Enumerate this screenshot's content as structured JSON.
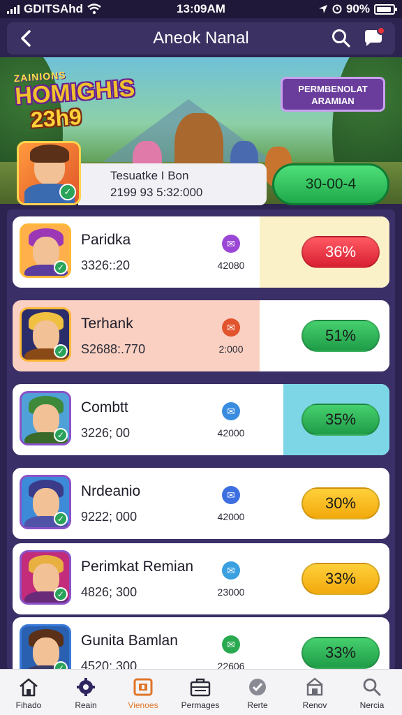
{
  "status_bar": {
    "carrier": "GDITSAhd",
    "time": "13:09AM",
    "battery": "90%",
    "battery_level": 0.9
  },
  "header": {
    "title": "Aneok Nanal",
    "back_icon": "chevron-left-icon",
    "search_icon": "search-icon",
    "chat_icon": "chat-bubble-icon"
  },
  "banner": {
    "logo_top": "ZAINIONS",
    "logo_main": "HOMIGHIS",
    "logo_num": "23h9",
    "badge_text": "PERMBENOLAT ARAMIAN"
  },
  "featured": {
    "line1": "Tesuatke I Bon",
    "line2": "2199 93 5:32:000",
    "score": "30-00-4"
  },
  "rows": [
    {
      "name": "Paridka",
      "amount": "3326::20",
      "count": "42080",
      "pct": "36%",
      "pct_value": 36,
      "pct_style": "red",
      "accent": "#fbf1c8",
      "accent_width": 186,
      "icon_color": "#9b47d6",
      "frame": "#ffb838",
      "hair": "#9c38b6",
      "body": "#5a3d9e",
      "bg": "#ffb04a"
    },
    {
      "name": "Terhank",
      "amount": "S2688:.770",
      "count": "2:000",
      "pct": "51%",
      "pct_value": 51,
      "pct_style": "green",
      "accent": "#f7b7a4",
      "accent_width": 186,
      "icon_color": "#e2542d",
      "frame": "#ffb838",
      "hair": "#f0c040",
      "body": "#8a4a18",
      "bg": "#2b2d6a",
      "full_left": "#fad0c2"
    },
    {
      "name": "Combtt",
      "amount": "3226; 00",
      "count": "42000",
      "pct": "35%",
      "pct_value": 35,
      "pct_style": "green",
      "accent": "#7cd6e6",
      "accent_width": 152,
      "icon_color": "#3a8ce0",
      "frame": "#8a52c8",
      "hair": "#3e8a3a",
      "body": "#3a6a2a",
      "bg": "#4fa1d8"
    },
    {
      "name": "Nrdeanio",
      "amount": "9222; 000",
      "count": "42000",
      "pct": "30%",
      "pct_value": 30,
      "pct_style": "yellow",
      "accent": "#ffffff",
      "accent_width": 0,
      "icon_color": "#3d6fe0",
      "frame": "#8a52c8",
      "hair": "#3a3c8a",
      "body": "#5052a8",
      "bg": "#3c8ad8"
    },
    {
      "name": "Perimkat Remian",
      "amount": "4826; 300",
      "count": "23000",
      "pct": "33%",
      "pct_value": 33,
      "pct_style": "yellow",
      "accent": "#ffffff",
      "accent_width": 0,
      "icon_color": "#3aa0e0",
      "frame": "#8a52c8",
      "hair": "#e8b040",
      "body": "#6a2a7a",
      "bg": "#c22c7a"
    },
    {
      "name": "Gunita Bamlan",
      "amount": "4520; 300",
      "count": "22606",
      "pct": "33%",
      "pct_value": 33,
      "pct_style": "green",
      "accent": "#ffffff",
      "accent_width": 0,
      "icon_color": "#2aaa50",
      "frame": "#3a7ad8",
      "hair": "#5a3018",
      "body": "#3a3a6a",
      "bg": "#2a60b0"
    }
  ],
  "nav": [
    {
      "label": "Fihado",
      "icon": "home-icon",
      "active": false
    },
    {
      "label": "Reain",
      "icon": "gear-icon",
      "active": false
    },
    {
      "label": "Vienoes",
      "icon": "gamepad-icon",
      "active": true
    },
    {
      "label": "Permages",
      "icon": "briefcase-icon",
      "active": false
    },
    {
      "label": "Rerte",
      "icon": "shield-check-icon",
      "active": false
    },
    {
      "label": "Renov",
      "icon": "store-icon",
      "active": false
    },
    {
      "label": "Nercia",
      "icon": "search-icon",
      "active": false
    }
  ],
  "colors": {
    "primary": "#2d2350",
    "header": "#3b3263",
    "green": "#1fa84a",
    "red": "#d81f32",
    "yellow": "#f2a90c",
    "active_nav": "#e0752a"
  }
}
